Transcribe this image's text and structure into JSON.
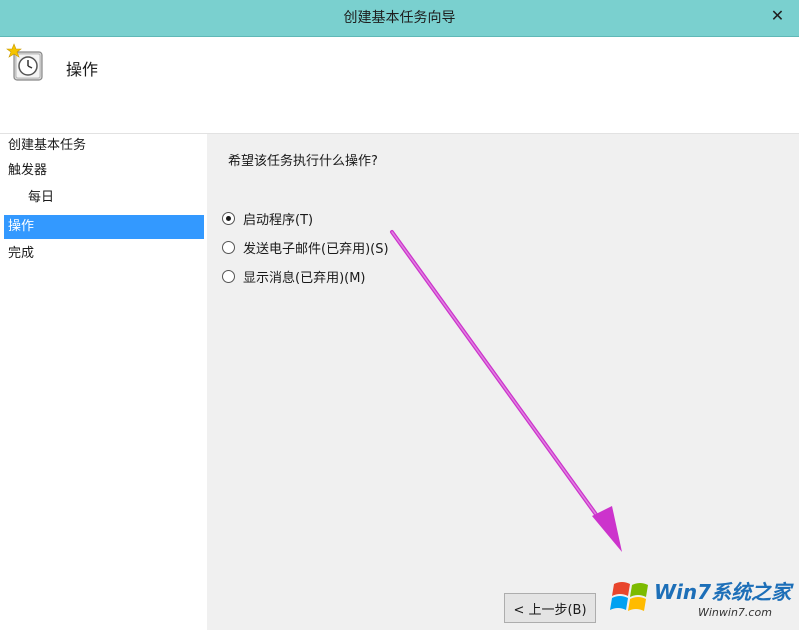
{
  "window": {
    "title": "创建基本任务向导",
    "close_symbol": "✕"
  },
  "header": {
    "title": "操作",
    "icon": "task-clock-icon"
  },
  "sidebar": {
    "items": [
      {
        "label": "创建基本任务"
      },
      {
        "label": "触发器"
      },
      {
        "label": "每日"
      },
      {
        "label": "操作"
      },
      {
        "label": "完成"
      }
    ],
    "selected": "操作"
  },
  "main": {
    "question": "希望该任务执行什么操作?",
    "options": [
      {
        "label": "启动程序(T)",
        "checked": true
      },
      {
        "label": "发送电子邮件(已弃用)(S)",
        "checked": false
      },
      {
        "label": "显示消息(已弃用)(M)",
        "checked": false
      }
    ]
  },
  "footer": {
    "back_label": "< 上一步(B)"
  },
  "watermark": {
    "brand": "Win7系统之家",
    "site": "Winwin7.com"
  },
  "colors": {
    "titlebar": "#7ad0cf",
    "selection": "#3399ff",
    "annotation_arrow": "#cc33cc"
  }
}
